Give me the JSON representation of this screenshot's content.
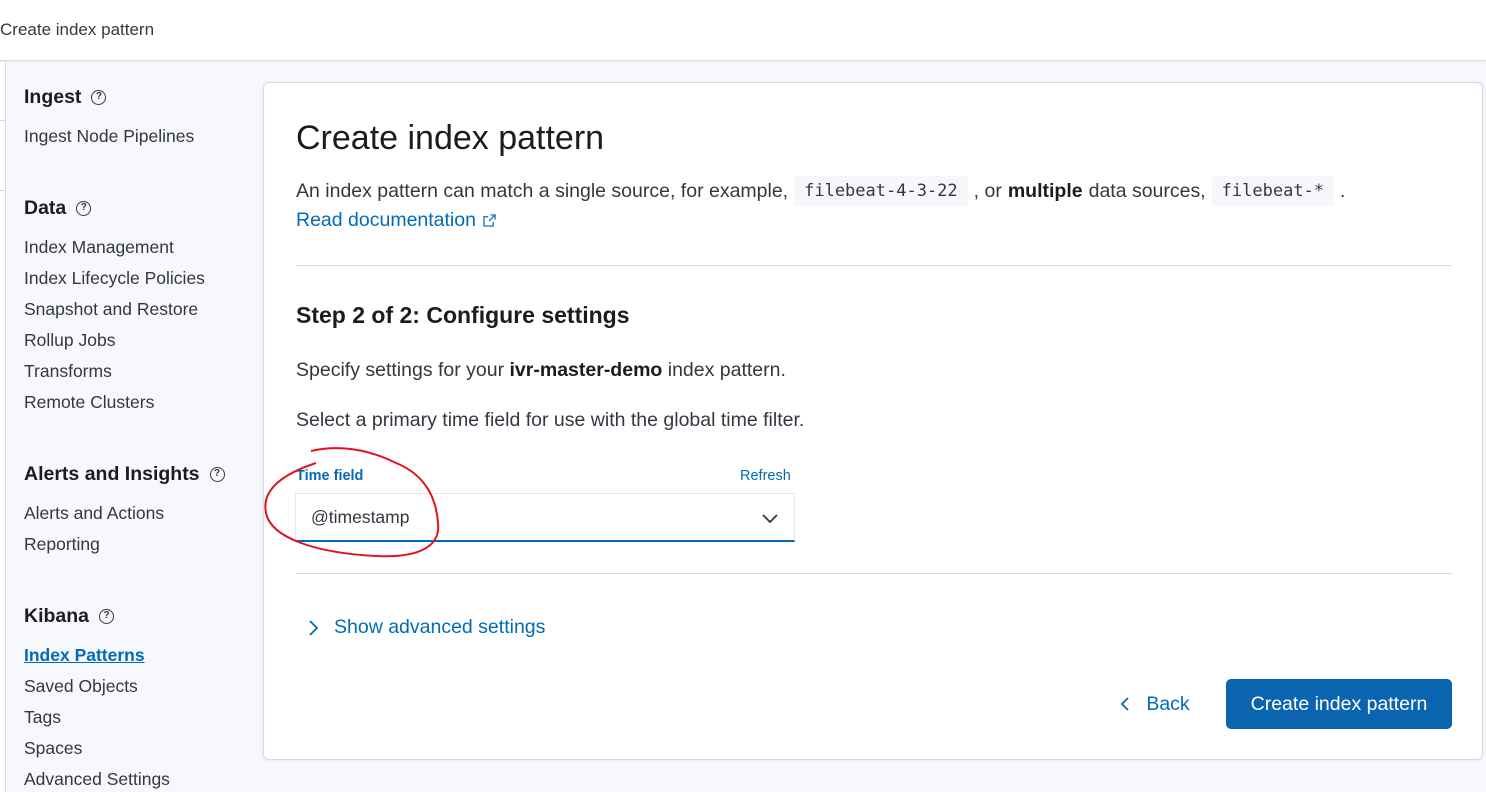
{
  "header": {
    "breadcrumb": "Create index pattern"
  },
  "sidebar": {
    "sections": [
      {
        "title": "Ingest",
        "items": [
          "Ingest Node Pipelines"
        ]
      },
      {
        "title": "Data",
        "items": [
          "Index Management",
          "Index Lifecycle Policies",
          "Snapshot and Restore",
          "Rollup Jobs",
          "Transforms",
          "Remote Clusters"
        ]
      },
      {
        "title": "Alerts and Insights",
        "items": [
          "Alerts and Actions",
          "Reporting"
        ]
      },
      {
        "title": "Kibana",
        "items": [
          "Index Patterns",
          "Saved Objects",
          "Tags",
          "Spaces",
          "Advanced Settings"
        ]
      }
    ],
    "active_item": "Index Patterns",
    "help_glyph": "?"
  },
  "main": {
    "title": "Create index pattern",
    "description": {
      "part1": "An index pattern can match a single source, for example,",
      "code1": "filebeat-4-3-22",
      "part2": ", or",
      "bold": "multiple",
      "part3": "data sources,",
      "code2": "filebeat-*",
      "part4": "."
    },
    "doc_link": "Read documentation",
    "step_title": "Step 2 of 2: Configure settings",
    "specify": {
      "prefix": "Specify settings for your",
      "index_name": "ivr-master-demo",
      "suffix": "index pattern."
    },
    "select_text": "Select a primary time field for use with the global time filter.",
    "time_field": {
      "label": "Time field",
      "refresh": "Refresh",
      "value": "@timestamp"
    },
    "advanced_toggle": "Show advanced settings",
    "back_label": "Back",
    "create_label": "Create index pattern"
  },
  "colors": {
    "link": "#006bb8",
    "primary_button": "#0b64b0",
    "annotation": "#e0141e"
  },
  "icons": [
    "help-icon",
    "external-link-icon",
    "chevron-down-icon",
    "chevron-right-icon",
    "chevron-left-icon"
  ]
}
